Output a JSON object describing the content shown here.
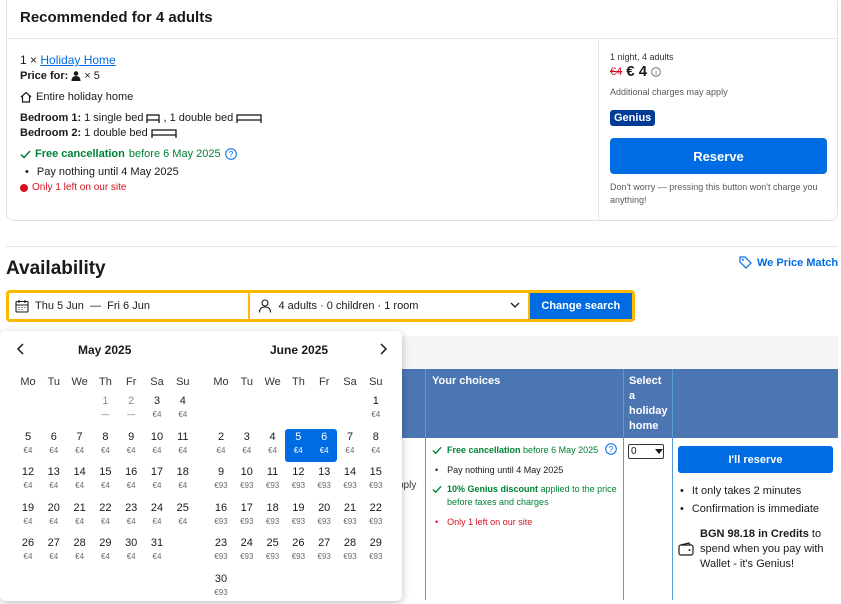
{
  "recommend": {
    "title": "Recommended for 4 adults",
    "qty": "1 ×",
    "room_name": "Holiday Home",
    "price_for_label": "Price for:",
    "price_for_count": "× 5",
    "entire": "Entire holiday home",
    "bedroom1_label": "Bedroom 1:",
    "bedroom1_text": "1 single bed",
    "bedroom1_text2": ", 1 double bed",
    "bedroom2_label": "Bedroom 2:",
    "bedroom2_text": "1 double bed",
    "free_cancel": "Free cancellation",
    "free_cancel_rest": "before 6 May 2025",
    "pay_nothing": "Pay nothing until 4 May 2025",
    "only_left": "Only 1 left on our site",
    "nights": "1 night, 4 adults",
    "old_price": "€4",
    "price": "€ 4",
    "charges": "Additional charges may apply",
    "genius": "Genius",
    "reserve": "Reserve",
    "dont_worry": "Don't worry — pressing this button won't charge you anything!"
  },
  "availability": {
    "title": "Availability",
    "price_match": "We Price Match",
    "date_range": "Thu 5 Jun  —  Fri 6 Jun",
    "guests": "4 adults · 0 children · 1 room",
    "change_search": "Change search"
  },
  "table": {
    "col_choices": "Your choices",
    "col_select": "Select a holiday home",
    "free_cancel": "Free cancellation",
    "free_cancel_rest": "before 6 May 2025",
    "pay_nothing": "Pay nothing until 4 May 2025",
    "genius_discount": "10% Genius discount",
    "genius_rest": "applied to the price before taxes and charges",
    "only_left": "Only 1 left on our site",
    "select_value": "0",
    "reserve": "I'll reserve",
    "bullet1": "It only takes 2 minutes",
    "bullet2": "Confirmation is immediate",
    "credits_bold": "BGN 98.18 in Credits",
    "credits_rest": "to spend when you pay with Wallet - it's Genius!",
    "partial_text": "pply"
  },
  "calendar": {
    "weekdays": [
      "Mo",
      "Tu",
      "We",
      "Th",
      "Fr",
      "Sa",
      "Su"
    ],
    "months": [
      {
        "name": "May 2025",
        "start": 3,
        "days": [
          {
            "d": "1",
            "p": "—",
            "dis": true
          },
          {
            "d": "2",
            "p": "—",
            "dis": true
          },
          {
            "d": "3",
            "p": "€4"
          },
          {
            "d": "4",
            "p": "€4"
          },
          {
            "d": "5",
            "p": "€4"
          },
          {
            "d": "6",
            "p": "€4"
          },
          {
            "d": "7",
            "p": "€4"
          },
          {
            "d": "8",
            "p": "€4"
          },
          {
            "d": "9",
            "p": "€4"
          },
          {
            "d": "10",
            "p": "€4"
          },
          {
            "d": "11",
            "p": "€4"
          },
          {
            "d": "12",
            "p": "€4"
          },
          {
            "d": "13",
            "p": "€4"
          },
          {
            "d": "14",
            "p": "€4"
          },
          {
            "d": "15",
            "p": "€4"
          },
          {
            "d": "16",
            "p": "€4"
          },
          {
            "d": "17",
            "p": "€4"
          },
          {
            "d": "18",
            "p": "€4"
          },
          {
            "d": "19",
            "p": "€4"
          },
          {
            "d": "20",
            "p": "€4"
          },
          {
            "d": "21",
            "p": "€4"
          },
          {
            "d": "22",
            "p": "€4"
          },
          {
            "d": "23",
            "p": "€4"
          },
          {
            "d": "24",
            "p": "€4"
          },
          {
            "d": "25",
            "p": "€4"
          },
          {
            "d": "26",
            "p": "€4"
          },
          {
            "d": "27",
            "p": "€4"
          },
          {
            "d": "28",
            "p": "€4"
          },
          {
            "d": "29",
            "p": "€4"
          },
          {
            "d": "30",
            "p": "€4"
          },
          {
            "d": "31",
            "p": "€4"
          }
        ]
      },
      {
        "name": "June 2025",
        "start": 6,
        "days": [
          {
            "d": "1",
            "p": "€4"
          },
          {
            "d": "2",
            "p": "€4"
          },
          {
            "d": "3",
            "p": "€4"
          },
          {
            "d": "4",
            "p": "€4"
          },
          {
            "d": "5",
            "p": "€4",
            "sel": true
          },
          {
            "d": "6",
            "p": "€4",
            "sel": true
          },
          {
            "d": "7",
            "p": "€4"
          },
          {
            "d": "8",
            "p": "€4"
          },
          {
            "d": "9",
            "p": "€93"
          },
          {
            "d": "10",
            "p": "€93"
          },
          {
            "d": "11",
            "p": "€93"
          },
          {
            "d": "12",
            "p": "€93"
          },
          {
            "d": "13",
            "p": "€93"
          },
          {
            "d": "14",
            "p": "€93"
          },
          {
            "d": "15",
            "p": "€93"
          },
          {
            "d": "16",
            "p": "€93"
          },
          {
            "d": "17",
            "p": "€93"
          },
          {
            "d": "18",
            "p": "€93"
          },
          {
            "d": "19",
            "p": "€93"
          },
          {
            "d": "20",
            "p": "€93"
          },
          {
            "d": "21",
            "p": "€93"
          },
          {
            "d": "22",
            "p": "€93"
          },
          {
            "d": "23",
            "p": "€93"
          },
          {
            "d": "24",
            "p": "€93"
          },
          {
            "d": "25",
            "p": "€93"
          },
          {
            "d": "26",
            "p": "€93"
          },
          {
            "d": "27",
            "p": "€93"
          },
          {
            "d": "28",
            "p": "€93"
          },
          {
            "d": "29",
            "p": "€93"
          },
          {
            "d": "30",
            "p": "€93"
          }
        ]
      }
    ]
  }
}
